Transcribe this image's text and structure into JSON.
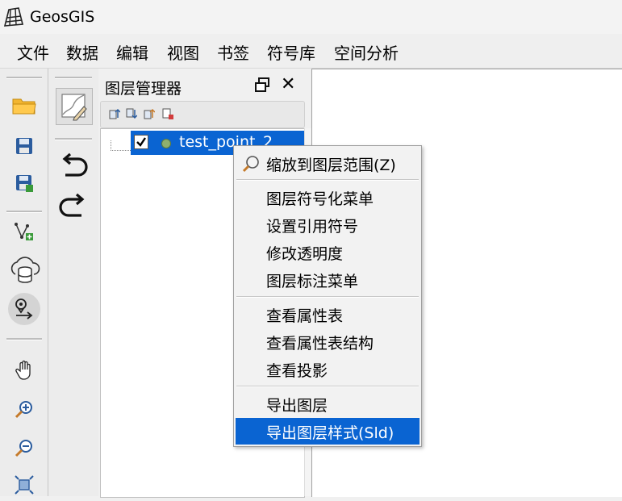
{
  "window": {
    "title": "GeosGIS"
  },
  "menubar": {
    "items": [
      "文件",
      "数据",
      "编辑",
      "视图",
      "书签",
      "符号库",
      "空间分析"
    ]
  },
  "toolbar_main": {
    "buttons": [
      "folder-open-icon",
      "save-icon",
      "save-as-icon",
      "add-vector-icon",
      "cloud-database-icon",
      "location-route-icon",
      "pan-hand-icon",
      "zoom-in-icon",
      "zoom-out-icon",
      "full-extent-icon"
    ]
  },
  "toolbar_edit": {
    "buttons": [
      "edit-map-icon",
      "undo-icon",
      "redo-icon"
    ]
  },
  "layer_manager": {
    "title": "图层管理器",
    "layers": [
      {
        "name": "test_point_2",
        "checked": true,
        "selected": true
      }
    ]
  },
  "context_menu": {
    "groups": [
      [
        "缩放到图层范围(Z)"
      ],
      [
        "图层符号化菜单",
        "设置引用符号",
        "修改透明度",
        "图层标注菜单"
      ],
      [
        "查看属性表",
        "查看属性表结构",
        "查看投影"
      ],
      [
        "导出图层",
        "导出图层样式(Sld)"
      ]
    ],
    "highlighted": "导出图层样式(Sld)"
  },
  "colors": {
    "selection": "#0a64d2",
    "accent_blue": "#1a64b8",
    "folder": "#f2b531"
  }
}
